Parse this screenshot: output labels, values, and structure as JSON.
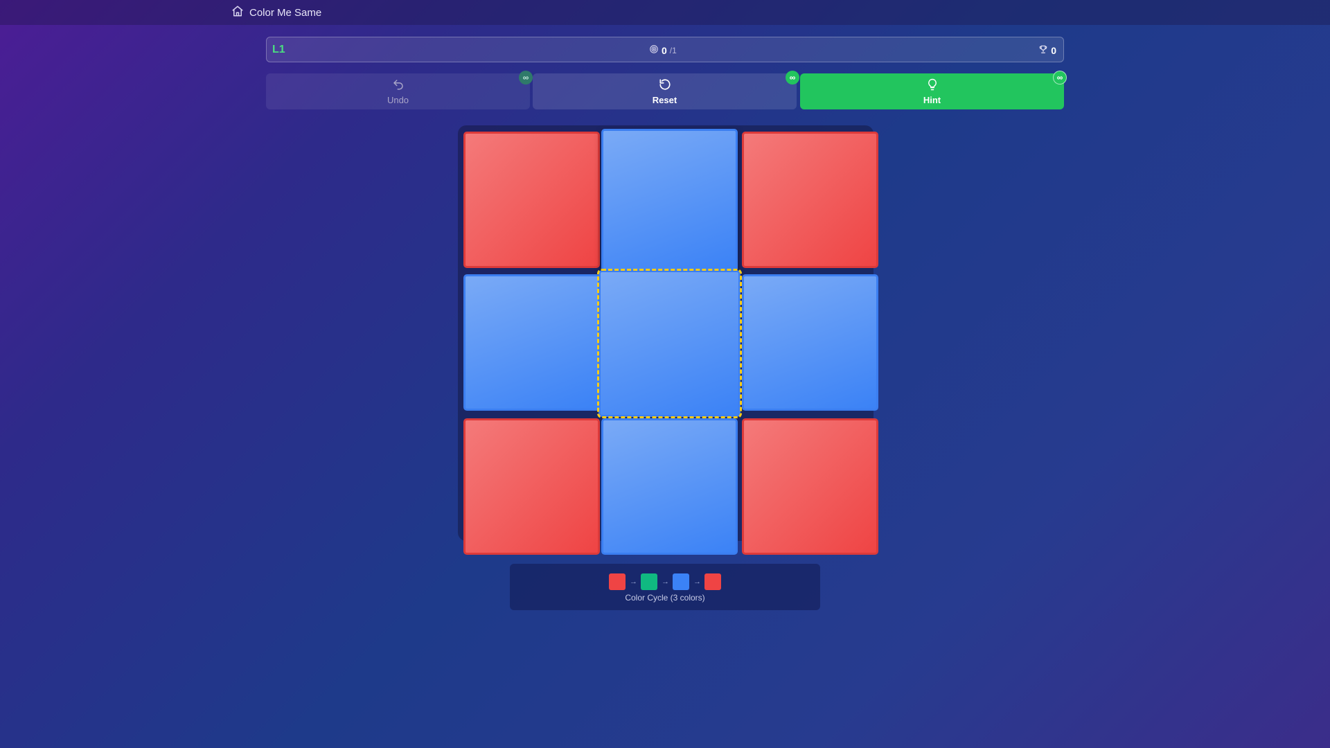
{
  "header": {
    "app_title": "Color Me Same",
    "home_icon": "home-icon"
  },
  "status": {
    "level": "L1",
    "moves_current": "0",
    "moves_target": "/1",
    "score": "0",
    "moves_icon": "target-icon",
    "score_icon": "trophy-icon"
  },
  "actions": {
    "undo": {
      "label": "Undo",
      "badge": "∞",
      "icon": "undo-icon"
    },
    "reset": {
      "label": "Reset",
      "badge": "∞",
      "icon": "reset-icon"
    },
    "hint": {
      "label": "Hint",
      "badge": "∞",
      "icon": "lightbulb-icon"
    }
  },
  "board": {
    "rows": 3,
    "cols": 3,
    "cells": [
      [
        "red",
        "blue",
        "red"
      ],
      [
        "blue",
        "blue",
        "blue"
      ],
      [
        "red",
        "blue",
        "red"
      ]
    ],
    "selected_cell": [
      1,
      1
    ]
  },
  "colors": {
    "red": "#ef4444",
    "green": "#10b981",
    "blue": "#3b82f6",
    "accent_green": "#22c55e",
    "level_green": "#4ade80",
    "selection_yellow": "#facc15"
  },
  "legend": {
    "cycle": [
      "red",
      "green",
      "blue",
      "red"
    ],
    "label": "Color Cycle (3 colors)"
  }
}
